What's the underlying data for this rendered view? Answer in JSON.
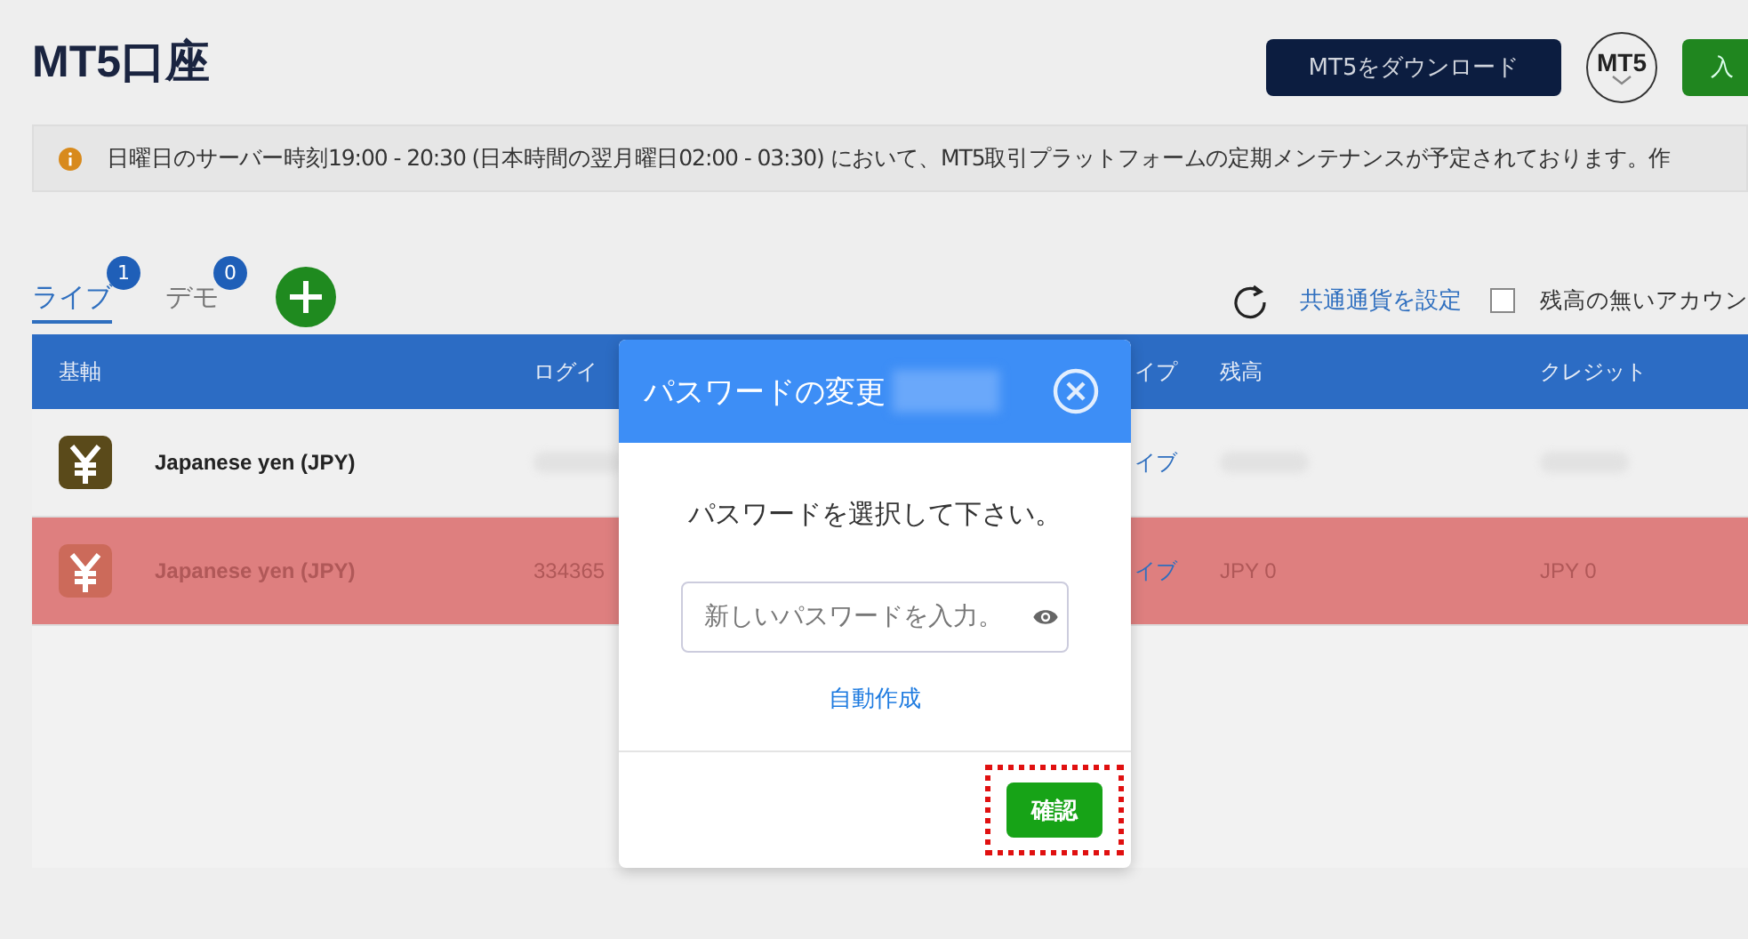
{
  "header": {
    "title": "MT5口座",
    "download_button": "MT5をダウンロード",
    "platform_badge": "MT5",
    "deposit_button": "入"
  },
  "notice": {
    "text": "日曜日のサーバー時刻19:00 - 20:30 (日本時間の翌月曜日02:00 - 03:30) において、MT5取引プラットフォームの定期メンテナンスが予定されております。作"
  },
  "tabs": [
    {
      "label": "ライブ",
      "badge": "1",
      "selected": true
    },
    {
      "label": "デモ",
      "badge": "0",
      "selected": false
    }
  ],
  "toolbar": {
    "currency_link": "共通通貨を設定",
    "hide_zero": {
      "label": "残高の無いアカウン",
      "checked": false
    }
  },
  "table": {
    "columns": [
      "基軸",
      "ログイ",
      "イプ",
      "残高",
      "クレジット"
    ],
    "rows": [
      {
        "highlighted": false,
        "cells": [
          "Japanese yen (JPY)",
          "",
          "イブ",
          "",
          ""
        ]
      },
      {
        "highlighted": true,
        "cells": [
          "Japanese yen (JPY)",
          "334365",
          "イブ",
          "JPY 0",
          "JPY 0"
        ]
      }
    ]
  },
  "dialog": {
    "title": "パスワードの変更",
    "message": "パスワードを選択して下さい。",
    "password_placeholder": "新しいパスワードを入力。",
    "generate_link": "自動作成",
    "confirm_button": "確認",
    "confirm_highlighted": true
  }
}
